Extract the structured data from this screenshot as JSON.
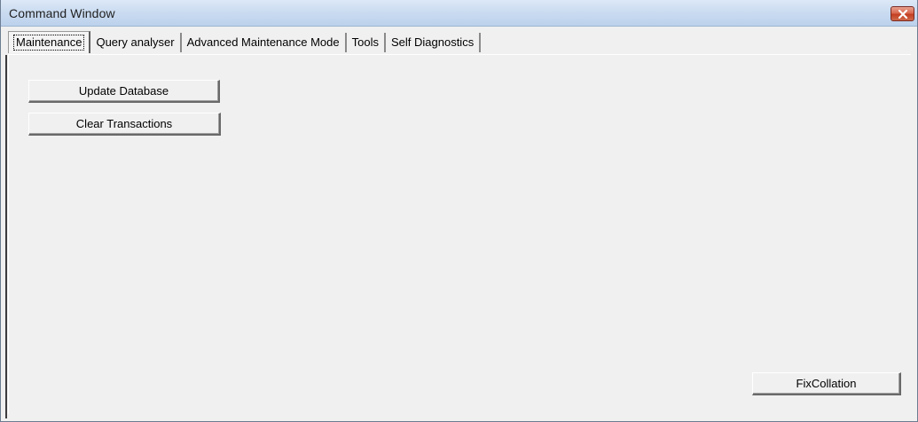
{
  "window": {
    "title": "Command Window",
    "close_icon": "close-icon",
    "close_color": "#c8452a"
  },
  "tabs": [
    {
      "label": "Maintenance",
      "active": true
    },
    {
      "label": "Query analyser",
      "active": false
    },
    {
      "label": "Advanced Maintenance Mode",
      "active": false
    },
    {
      "label": "Tools",
      "active": false
    },
    {
      "label": "Self Diagnostics",
      "active": false
    }
  ],
  "maintenance": {
    "update_database_label": "Update Database",
    "clear_transactions_label": "Clear Transactions",
    "fix_collation_label": "FixCollation"
  }
}
